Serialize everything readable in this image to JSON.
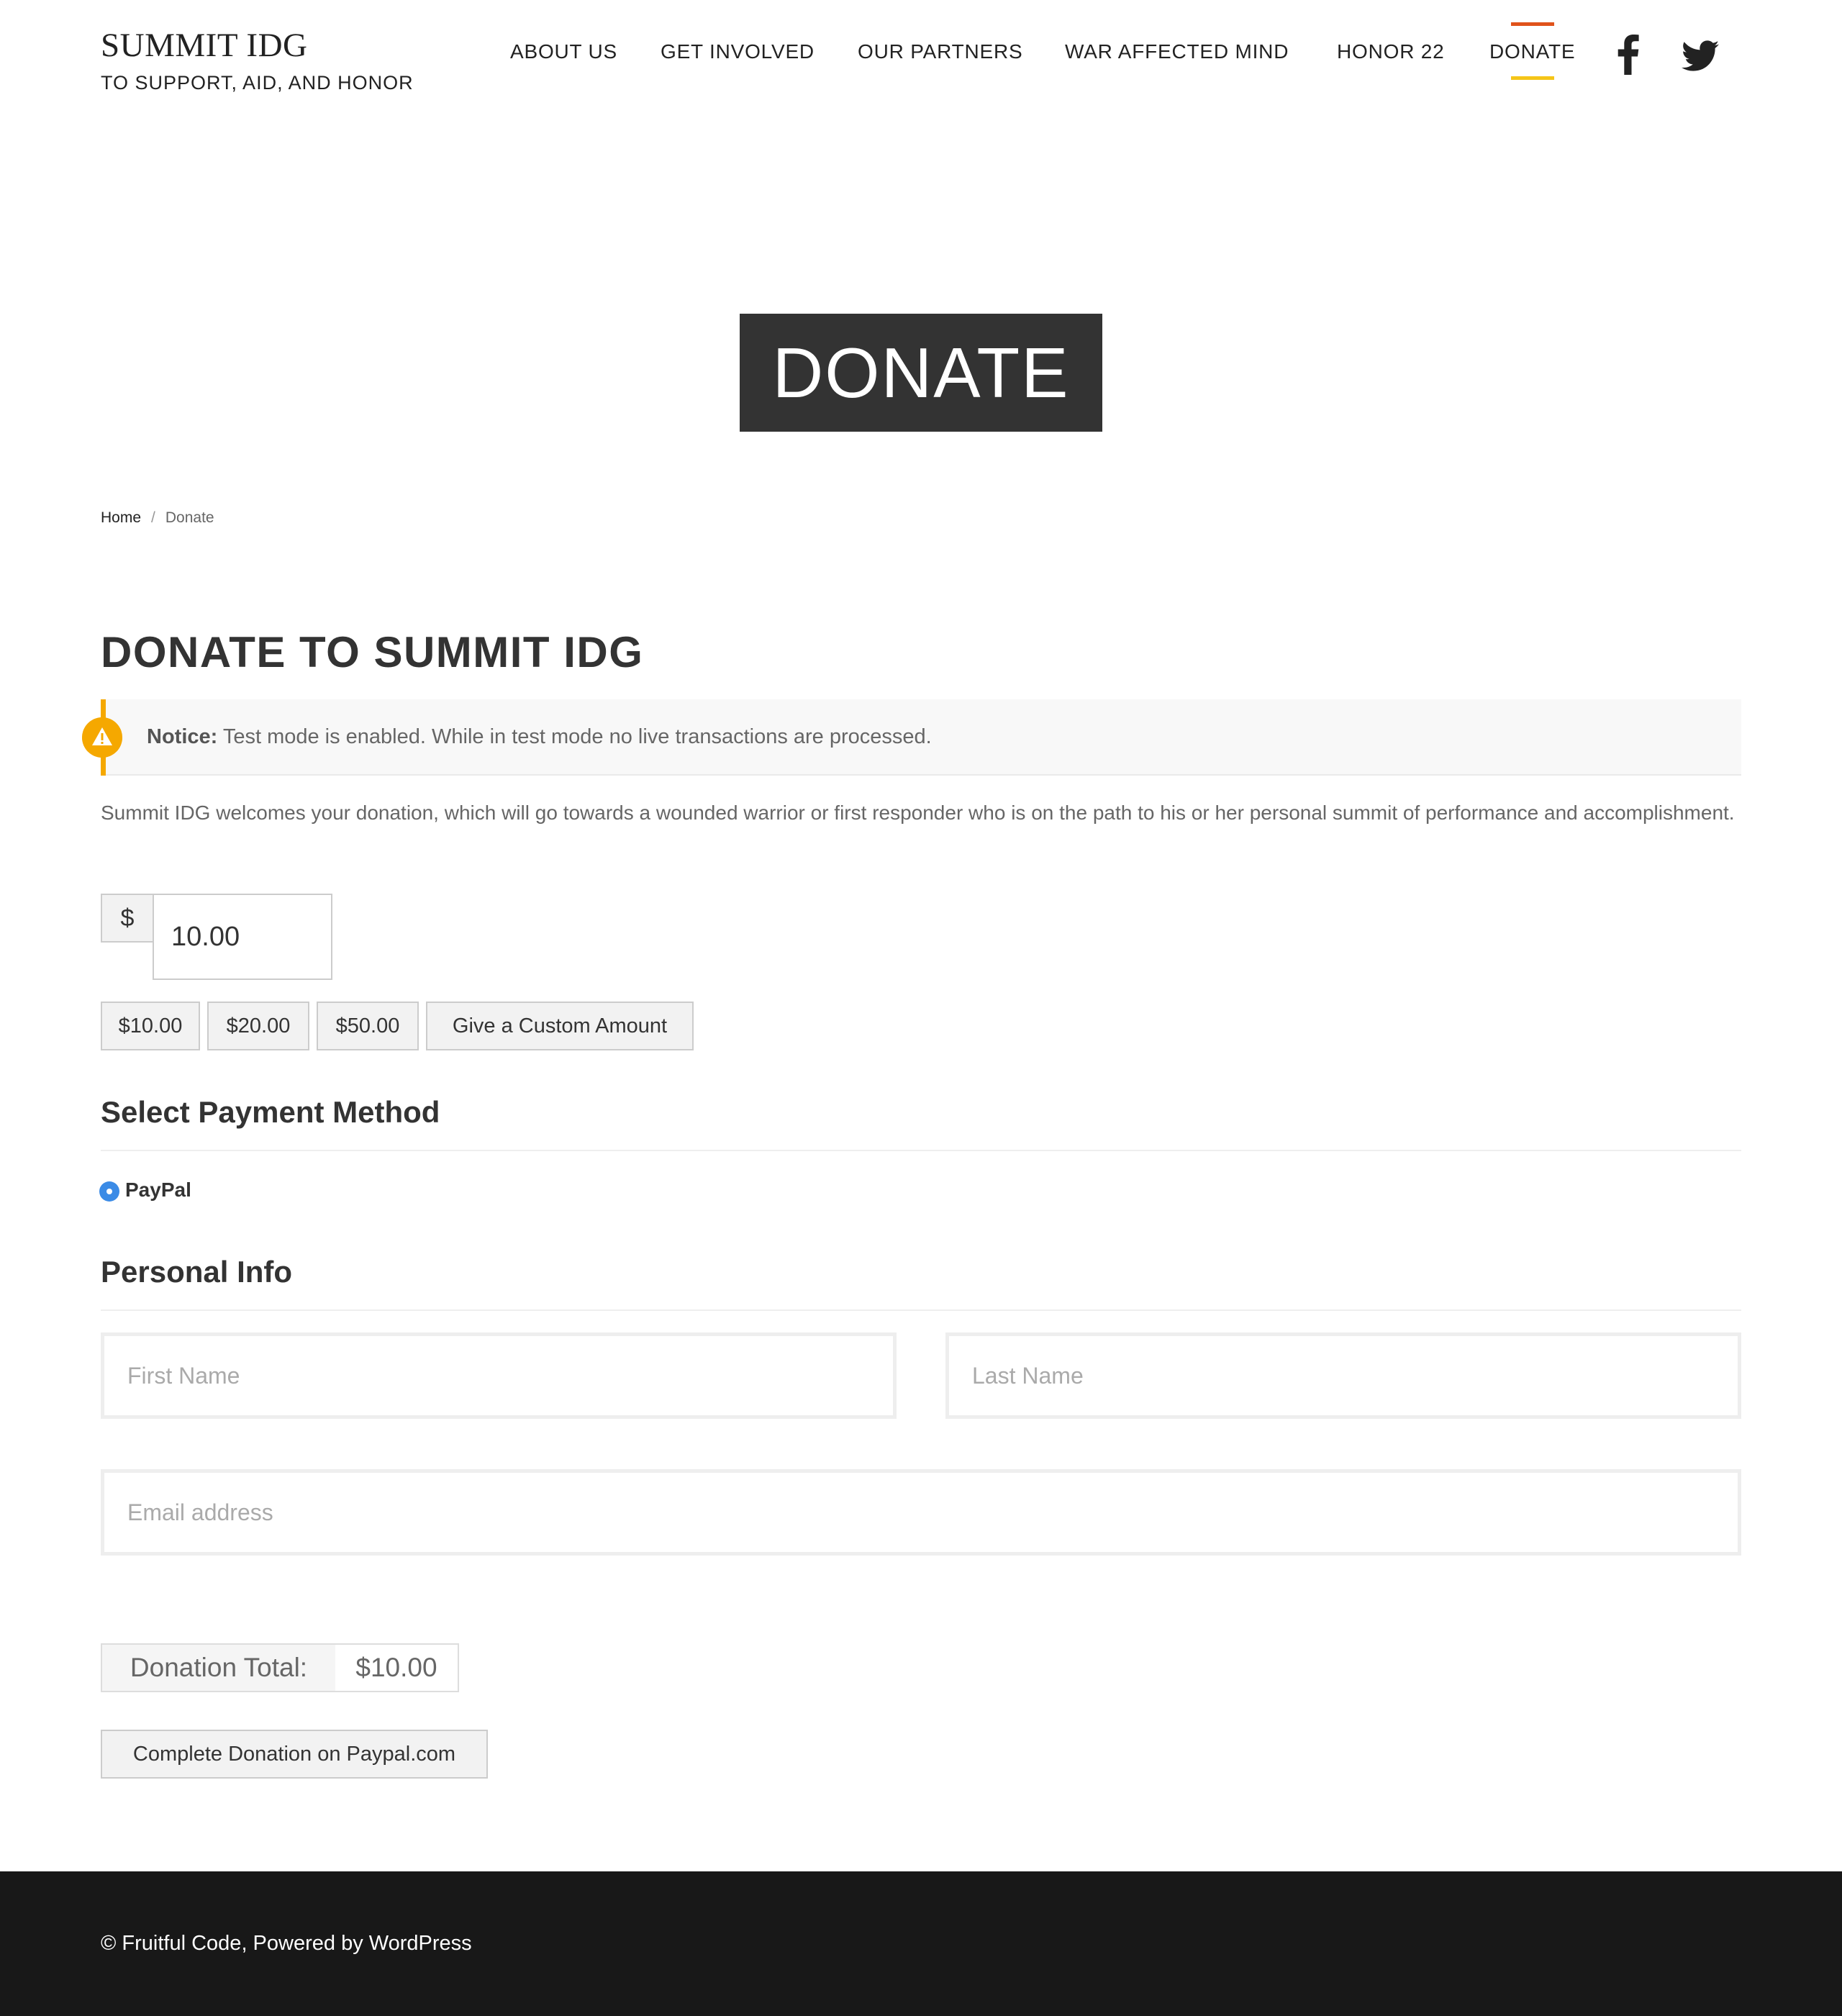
{
  "header": {
    "site_title": "SUMMIT IDG",
    "tagline": "TO SUPPORT, AID, AND HONOR",
    "nav": [
      {
        "label": "ABOUT US"
      },
      {
        "label": "GET INVOLVED"
      },
      {
        "label": "OUR PARTNERS"
      },
      {
        "label": "WAR AFFECTED MIND"
      },
      {
        "label": "HONOR 22"
      },
      {
        "label": "DONATE",
        "active": true
      }
    ],
    "social": [
      "facebook-icon",
      "twitter-icon"
    ]
  },
  "hero": {
    "title": "DONATE"
  },
  "breadcrumb": {
    "home": "Home",
    "separator": "/",
    "current": "Donate"
  },
  "form": {
    "heading": "DONATE TO SUMMIT IDG",
    "notice": {
      "label": "Notice:",
      "text": " Test mode is enabled. While in test mode no live transactions are processed."
    },
    "intro": "Summit IDG welcomes your donation, which will go towards a wounded warrior or first responder who is on the path to his or her personal summit of performance and accomplishment.",
    "currency_symbol": "$",
    "amount": "10.00",
    "levels": [
      "$10.00",
      "$20.00",
      "$50.00",
      "Give a Custom Amount"
    ],
    "payment_heading": "Select Payment Method",
    "payment_option": "PayPal",
    "personal_heading": "Personal Info",
    "first_name_placeholder": "First Name",
    "last_name_placeholder": "Last Name",
    "email_placeholder": "Email address",
    "total_label": "Donation Total:",
    "total_value": "$10.00",
    "submit_label": "Complete Donation on Paypal.com"
  },
  "footer": {
    "text": "© Fruitful Code, Powered by WordPress"
  },
  "colors": {
    "accent_top": "#e0531b",
    "accent_bottom": "#f5c518",
    "notice": "#f5a800",
    "radio": "#3b8be6",
    "footer_bg": "#181818",
    "hero_bg": "#333333"
  }
}
